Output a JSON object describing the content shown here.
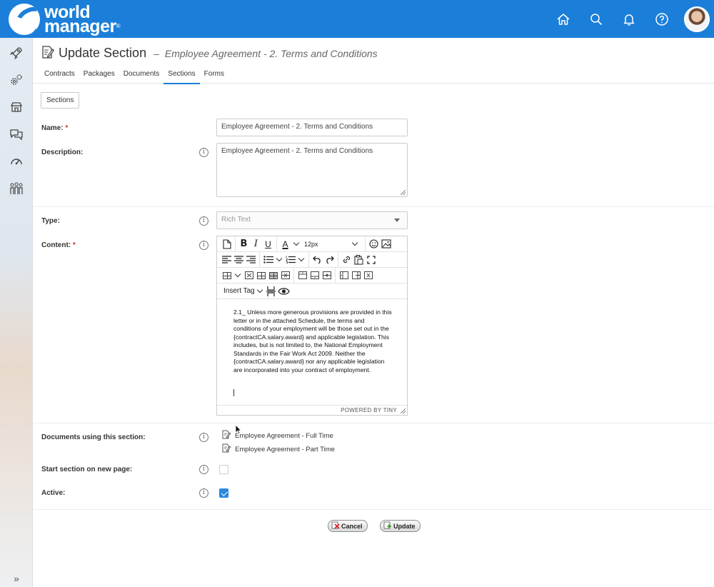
{
  "app": {
    "logo_line1": "world",
    "logo_line2": "manager",
    "logo_mark": "®"
  },
  "topbar": {
    "icons": [
      "home-icon",
      "search-icon",
      "bell-icon",
      "help-icon"
    ],
    "accent_color": "#1b7fd9"
  },
  "sidebar": {
    "items": [
      "rocket-icon",
      "gears-icon",
      "store-icon",
      "chat-icon",
      "speedometer-icon",
      "people-icon"
    ],
    "expand": "»"
  },
  "page": {
    "title": "Update Section",
    "dash": "–",
    "subtitle": "Employee Agreement - 2. Terms and Conditions",
    "tabs": [
      {
        "label": "Contracts",
        "active": false
      },
      {
        "label": "Packages",
        "active": false
      },
      {
        "label": "Documents",
        "active": false
      },
      {
        "label": "Sections",
        "active": true
      },
      {
        "label": "Forms",
        "active": false
      }
    ],
    "sections_button": "Sections"
  },
  "form": {
    "name_label": "Name:",
    "name_value": "Employee Agreement - 2. Terms and Conditions",
    "description_label": "Description:",
    "description_value": "Employee Agreement - 2. Terms and Conditions",
    "type_label": "Type:",
    "type_value": "Rich Text",
    "content_label": "Content:",
    "required_mark": "*",
    "info_glyph": "i",
    "docs_label": "Documents using this section:",
    "docs": [
      "Employee Agreement - Full Time",
      "Employee Agreement - Part Time"
    ],
    "new_page_label": "Start section on new page:",
    "new_page_checked": false,
    "active_label": "Active:",
    "active_checked": true
  },
  "editor": {
    "font_size": "12px",
    "insert_tag": "Insert Tag",
    "content": "2.1_ Unless more generous provisions are provided in this letter or in the attached Schedule, the terms and conditions of your employment will be those set out in the {contractCA.salary.award} and applicable legislation. This includes, but is not limited to, the National Employment Standards in the Fair Work Act 2009. Neither the {contractCA.salary.award} nor any applicable legislation are incorporated into your contract of employment.",
    "powered_by": "POWERED BY TINY",
    "bold": "B",
    "italic": "I",
    "underline": "U",
    "font_color": "A"
  },
  "actions": {
    "cancel": "Cancel",
    "update": "Update"
  }
}
